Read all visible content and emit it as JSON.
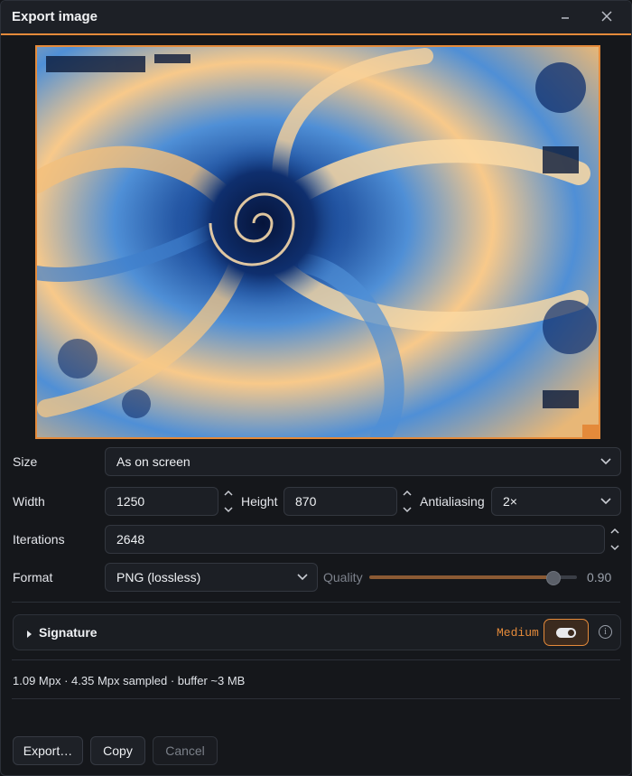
{
  "window": {
    "title": "Export image",
    "minimize_icon": "minimize-icon",
    "close_icon": "close-icon"
  },
  "preview": {
    "alt": "fractal spiral preview",
    "colors": {
      "orange": "#e48a3a",
      "light_orange": "#f8c98a",
      "blue": "#4f8fd6",
      "deep_blue": "#0d2a63"
    }
  },
  "form": {
    "size_label": "Size",
    "size_value": "As on screen",
    "width_label": "Width",
    "width_value": "1250",
    "height_label": "Height",
    "height_value": "870",
    "antialiasing_label": "Antialiasing",
    "antialiasing_value": "2×",
    "iterations_label": "Iterations",
    "iterations_value": "2648",
    "format_label": "Format",
    "format_value": "PNG (lossless)",
    "quality_label": "Quality",
    "quality_value": "0.90",
    "quality_fraction": 0.9
  },
  "signature": {
    "title": "Signature",
    "level": "Medium",
    "toggle_on": true,
    "info_icon": "info-icon"
  },
  "stats": "1.09 Mpx · 4.35 Mpx sampled · buffer ~3 MB",
  "buttons": {
    "export": "Export…",
    "copy": "Copy",
    "cancel": "Cancel"
  }
}
